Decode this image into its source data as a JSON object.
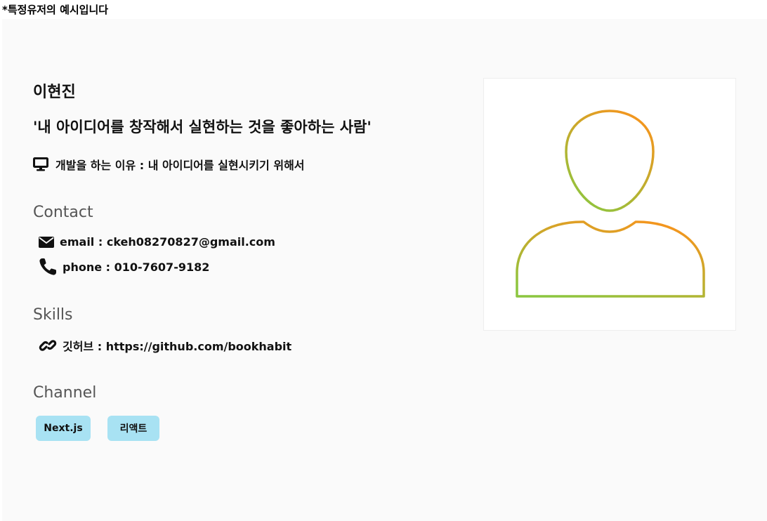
{
  "notice": "*특정유저의 예시입니다",
  "profile": {
    "name": "이현진",
    "slogan": "'내 아이디어를 창작해서 실현하는 것을 좋아하는 사람'",
    "reason": "개발을 하는 이유 : 내 아이디어를 실현시키기 위해서"
  },
  "contact": {
    "title": "Contact",
    "email": "email : ckeh08270827@gmail.com",
    "phone": "phone : 010-7607-9182"
  },
  "skills": {
    "title": "Skills",
    "github": "깃허브 : https://github.com/bookhabit"
  },
  "channel": {
    "title": "Channel",
    "chips": [
      "Next.js",
      "리액트"
    ]
  },
  "icons": [
    "desktop-icon",
    "envelope-icon",
    "phone-icon",
    "link-icon",
    "user-avatar-icon"
  ],
  "colors": {
    "panel_bg": "#fafafa",
    "chip_bg": "#a8e2f3",
    "avatar_gradient_start": "#f7941d",
    "avatar_gradient_end": "#8cc63f",
    "section_title": "#555555"
  }
}
